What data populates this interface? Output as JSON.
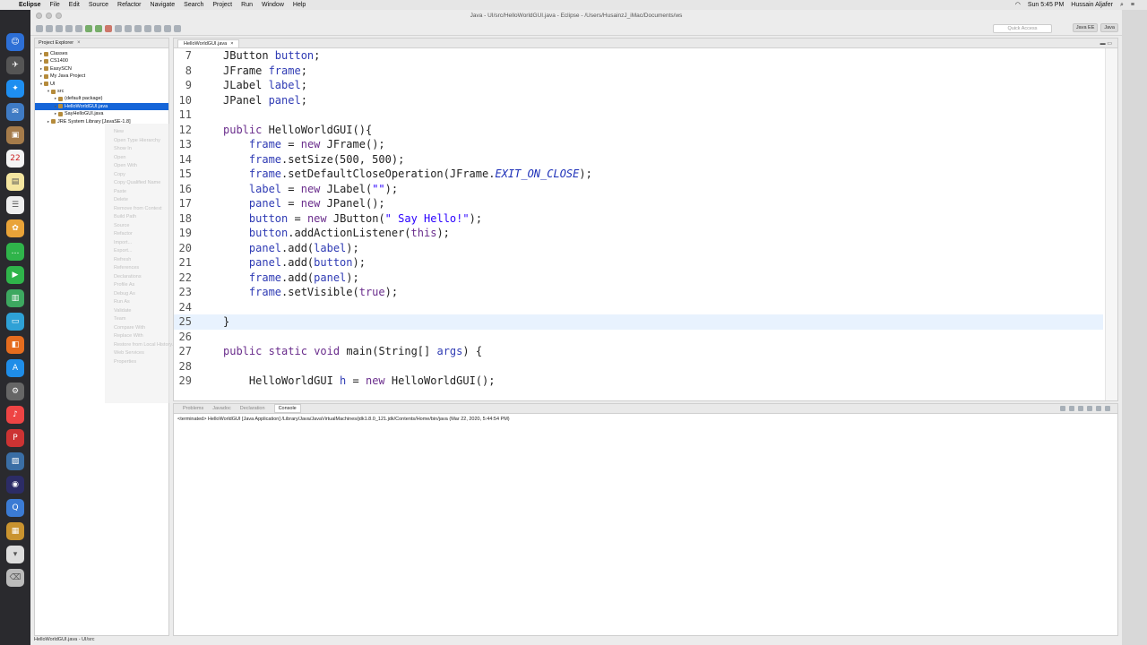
{
  "menubar": {
    "app": "Eclipse",
    "items": [
      "File",
      "Edit",
      "Source",
      "Refactor",
      "Navigate",
      "Search",
      "Project",
      "Run",
      "Window",
      "Help"
    ],
    "clock": "Sun 5:45 PM",
    "user": "Hussain Aljafer"
  },
  "window": {
    "title": "Java - UI/src/HelloWorldGUI.java - Eclipse - /Users/HusainzJ_iMac/Documents/ws",
    "quick_access": "Quick Access",
    "perspectives": [
      "Java EE",
      "Java"
    ]
  },
  "explorer": {
    "title": "Project Explorer",
    "tree": [
      {
        "label": "Classes",
        "indent": 0,
        "arrow": "▸"
      },
      {
        "label": "CS1400",
        "indent": 0,
        "arrow": "▸"
      },
      {
        "label": "EasySCN",
        "indent": 0,
        "arrow": "▸"
      },
      {
        "label": "My Java Project",
        "indent": 0,
        "arrow": "▸"
      },
      {
        "label": "UI",
        "indent": 0,
        "arrow": "▾"
      },
      {
        "label": "src",
        "indent": 1,
        "arrow": "▾"
      },
      {
        "label": "(default package)",
        "indent": 2,
        "arrow": "▸"
      },
      {
        "label": "HelloWorldGUI.java",
        "indent": 2,
        "arrow": "▸",
        "selected": true
      },
      {
        "label": "SayHelloGUI.java",
        "indent": 2,
        "arrow": "▸"
      },
      {
        "label": "JRE System Library [JavaSE-1.8]",
        "indent": 1,
        "arrow": "▸"
      }
    ],
    "ghost_menu": [
      "New",
      "Open Type Hierarchy",
      "Show In",
      "Open",
      "Open With",
      "Copy",
      "Copy Qualified Name",
      "Paste",
      "Delete",
      "Remove from Context",
      "Build Path",
      "Source",
      "Refactor",
      "Import...",
      "Export...",
      "Refresh",
      "References",
      "Declarations",
      "Profile As",
      "Debug As",
      "Run As",
      "Validate",
      "Team",
      "Compare With",
      "Replace With",
      "Restore from Local History...",
      "Web Services",
      "Properties"
    ]
  },
  "editor": {
    "tab": "HelloWorldGUI.java",
    "lines": [
      {
        "n": "7",
        "html": "JButton <span class='fld'>button</span>;"
      },
      {
        "n": "8",
        "html": "JFrame <span class='fld'>frame</span>;"
      },
      {
        "n": "9",
        "html": "JLabel <span class='fld'>label</span>;"
      },
      {
        "n": "10",
        "html": "JPanel <span class='fld'>panel</span>;"
      },
      {
        "n": "11",
        "html": ""
      },
      {
        "n": "12",
        "html": "<span class='kw'>public</span> HelloWorldGUI(){"
      },
      {
        "n": "13",
        "html": "    <span class='fld'>frame</span> = <span class='kw'>new</span> JFrame();"
      },
      {
        "n": "14",
        "html": "    <span class='fld'>frame</span>.setSize(500, 500);"
      },
      {
        "n": "15",
        "html": "    <span class='fld'>frame</span>.setDefaultCloseOperation(JFrame.<span class='ital'>EXIT_ON_CLOSE</span>);"
      },
      {
        "n": "16",
        "html": "    <span class='fld'>label</span> = <span class='kw'>new</span> JLabel(<span class='str'>\"\"</span>);"
      },
      {
        "n": "17",
        "html": "    <span class='fld'>panel</span> = <span class='kw'>new</span> JPanel();"
      },
      {
        "n": "18",
        "html": "    <span class='fld'>button</span> = <span class='kw'>new</span> JButton(<span class='str'>\" Say Hello!\"</span>);"
      },
      {
        "n": "19",
        "html": "    <span class='fld'>button</span>.addActionListener(<span class='kw'>this</span>);"
      },
      {
        "n": "20",
        "html": "    <span class='fld'>panel</span>.add(<span class='fld'>label</span>);"
      },
      {
        "n": "21",
        "html": "    <span class='fld'>panel</span>.add(<span class='fld'>button</span>);"
      },
      {
        "n": "22",
        "html": "    <span class='fld'>frame</span>.add(<span class='fld'>panel</span>);"
      },
      {
        "n": "23",
        "html": "    <span class='fld'>frame</span>.setVisible(<span class='kw'>true</span>);"
      },
      {
        "n": "24",
        "html": ""
      },
      {
        "n": "25",
        "html": "}",
        "current": true
      },
      {
        "n": "26",
        "html": ""
      },
      {
        "n": "27",
        "html": "<span class='kw'>public</span> <span class='kw'>static</span> <span class='kw'>void</span> main(String[] <span class='fld'>args</span>) {"
      },
      {
        "n": "28",
        "html": ""
      },
      {
        "n": "29",
        "html": "    HelloWorldGUI <span class='fld'>h</span> = <span class='kw'>new</span> HelloWorldGUI();"
      }
    ]
  },
  "console": {
    "tabs": [
      "Problems",
      "Javadoc",
      "Declaration",
      "Console"
    ],
    "active_tab": "Console",
    "terminated_line": "<terminated> HelloWorldGUI [Java Application] /Library/Java/JavaVirtualMachines/jdk1.8.0_121.jdk/Contents/Home/bin/java (Mar 22, 2020, 5:44:54 PM)"
  },
  "status_bar": "HelloWorldGUI.java - UI/src"
}
